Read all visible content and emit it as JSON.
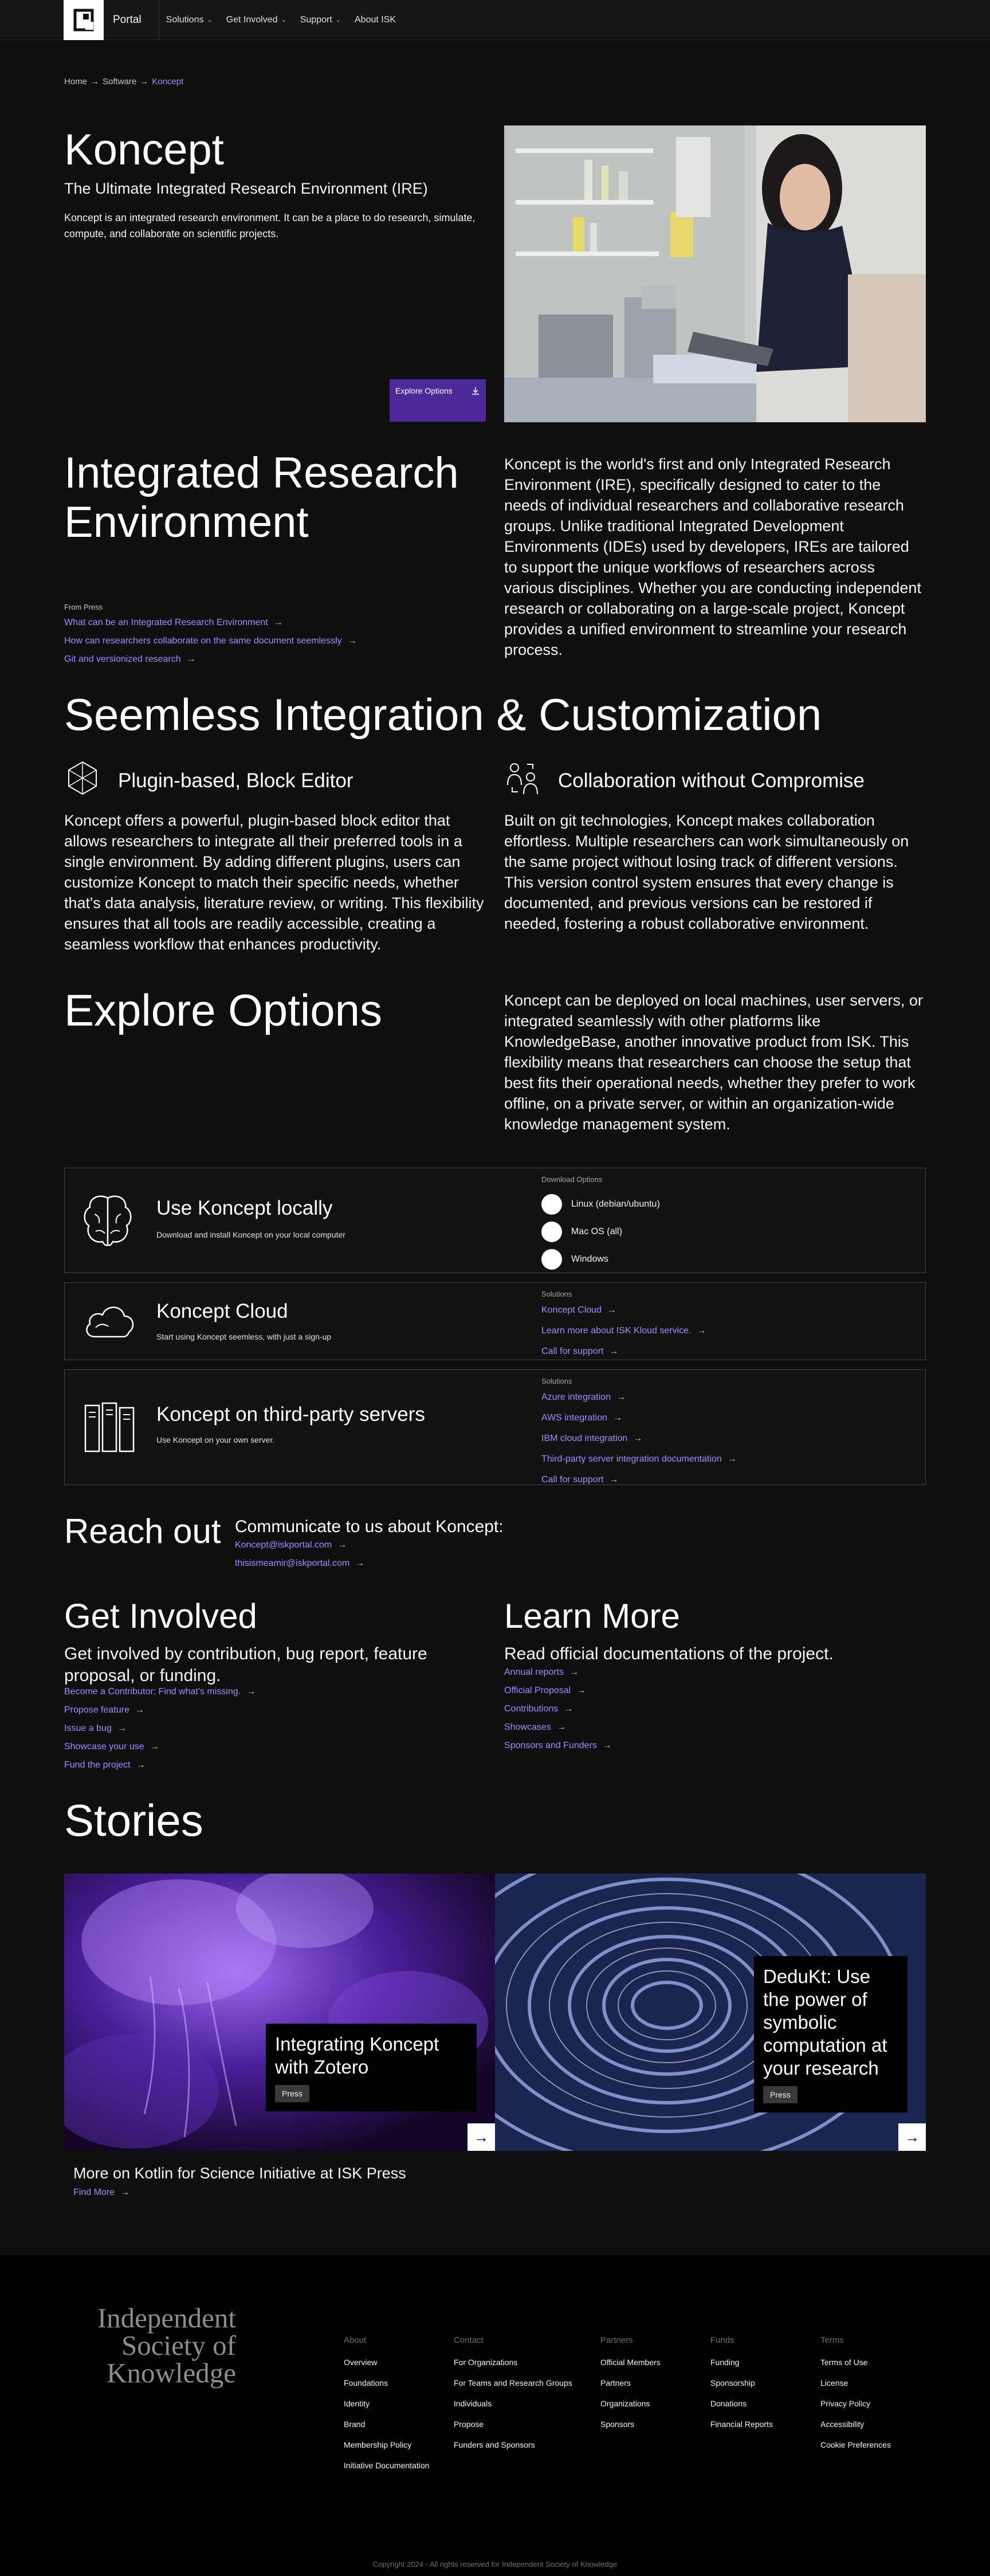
{
  "header": {
    "brand": "Portal",
    "nav": [
      {
        "label": "Solutions",
        "has_dropdown": true
      },
      {
        "label": "Get Involved",
        "has_dropdown": true
      },
      {
        "label": "Support",
        "has_dropdown": true
      },
      {
        "label": "About ISK",
        "has_dropdown": false
      }
    ]
  },
  "breadcrumb": {
    "items": [
      "Home",
      "Software",
      "Koncept"
    ]
  },
  "hero": {
    "title": "Koncept",
    "subtitle": "The Ultimate Integrated Research Environment (IRE)",
    "description": "Koncept is an integrated research environment. It can be a place to do research, simulate, compute, and collaborate on scientific projects.",
    "cta_label": "Explore Options"
  },
  "ire": {
    "title": "Integrated Research Environment",
    "body": "Koncept is the world's first and only Integrated Research Environment (IRE), specifically designed to cater to the needs of individual researchers and collaborative research groups. Unlike traditional Integrated Development Environments (IDEs) used by developers, IREs are tailored to support the unique workflows of researchers across various disciplines. Whether you are conducting independent research or collaborating on a large-scale project, Koncept provides a unified environment to streamline your research process.",
    "press_label": "From Press",
    "press_links": [
      "What can be an Integrated Research Environment",
      "How can researchers collaborate on the same document seemlessly",
      "Git and versionized research"
    ]
  },
  "integration": {
    "title": "Seemless Integration & Customization",
    "features": [
      {
        "title": "Plugin-based, Block Editor",
        "icon": "hexagon-icon",
        "body": "Koncept offers a powerful, plugin-based block editor that allows researchers to integrate all their preferred tools in a single environment. By adding different plugins, users can customize Koncept to match their specific needs, whether that's data analysis, literature review, or writing. This flexibility ensures that all tools are readily accessible, creating a seamless workflow that enhances productivity."
      },
      {
        "title": "Collaboration without Compromise",
        "icon": "collaboration-icon",
        "body": "Built on git technologies, Koncept makes collaboration effortless. Multiple researchers can work simultaneously on the same project without losing track of different versions. This version control system ensures that every change is documented, and previous versions can be restored if needed, fostering a robust collaborative environment."
      }
    ]
  },
  "explore": {
    "title": "Explore Options",
    "body": "Koncept can be deployed on local machines, user servers, or integrated seamlessly with other platforms like KnowledgeBase, another innovative product from ISK. This flexibility means that researchers can choose the setup that best fits their operational needs, whether they prefer to work offline, on a private server, or within an organization-wide knowledge management system.",
    "cards": [
      {
        "title": "Use Koncept locally",
        "desc": "Download and install Koncept on your local computer",
        "icon": "brain-icon",
        "right_label": "Download Options",
        "options": [
          "Linux (debian/ubuntu)",
          "Mac OS (all)",
          "Windows"
        ]
      },
      {
        "title": "Koncept Cloud",
        "desc": "Start using Koncept seemless, with just a sign-up",
        "icon": "cloud-icon",
        "right_label": "Solutions",
        "links": [
          "Koncept Cloud",
          "Learn more about ISK Kloud service.",
          "Call for support"
        ]
      },
      {
        "title": "Koncept on third-party servers",
        "desc": "Use Koncept on your own server.",
        "icon": "server-icon",
        "right_label": "Solutions",
        "links": [
          "Azure integration",
          "AWS integration",
          "IBM cloud integration",
          "Third-party server integration documentation",
          "Call for support"
        ]
      }
    ]
  },
  "reach": {
    "title": "Reach out",
    "subtitle": "Communicate to us about Koncept:",
    "emails": [
      "Koncept@iskportal.com",
      "thisismeamir@iskportal.com"
    ]
  },
  "get_involved": {
    "title": "Get Involved",
    "subtitle": "Get involved by contribution, bug report, feature proposal, or funding.",
    "links": [
      "Become a Contributor: Find what's missing.",
      "Propose feature",
      "Issue a bug",
      "Showcase your use",
      "Fund the project"
    ]
  },
  "learn_more": {
    "title": "Learn More",
    "subtitle": "Read official documentations of the project.",
    "links": [
      "Annual reports",
      "Official Proposal",
      "Contributions",
      "Showcases",
      "Sponsors and Funders"
    ]
  },
  "stories": {
    "title": "Stories",
    "items": [
      {
        "title": "Integrating Koncept with Zotero",
        "tag": "Press"
      },
      {
        "title": "DeduKt: Use the power of symbolic computation at your research",
        "tag": "Press"
      }
    ],
    "more_text": "More on Kotlin for Science Initiative at ISK Press",
    "find_more": "Find More"
  },
  "footer": {
    "logo_text": [
      "Independent",
      "Society of",
      "Knowledge"
    ],
    "columns": [
      {
        "head": "About",
        "items": [
          "Overview",
          "Foundations",
          "Identity",
          "Brand",
          "Membership Policy",
          "Initiative Documentation"
        ]
      },
      {
        "head": "Contact",
        "items": [
          "For Organizations",
          "For Teams and Research Groups",
          "Individuals",
          "Propose",
          "Funders and Sponsors"
        ]
      },
      {
        "head": "Partners",
        "items": [
          "Official Members",
          "Partners",
          "Organizations",
          "Sponsors"
        ]
      },
      {
        "head": "Funds",
        "items": [
          "Funding",
          "Sponsorship",
          "Donations",
          "Financial Reports"
        ]
      },
      {
        "head": "Terms",
        "items": [
          "Terms of Use",
          "License",
          "Privacy Policy",
          "Accessibility",
          "Cookie Preferences"
        ]
      }
    ],
    "copyright": "Copyright 2024 - All rights reserved for Independent Society of Knowledge"
  }
}
